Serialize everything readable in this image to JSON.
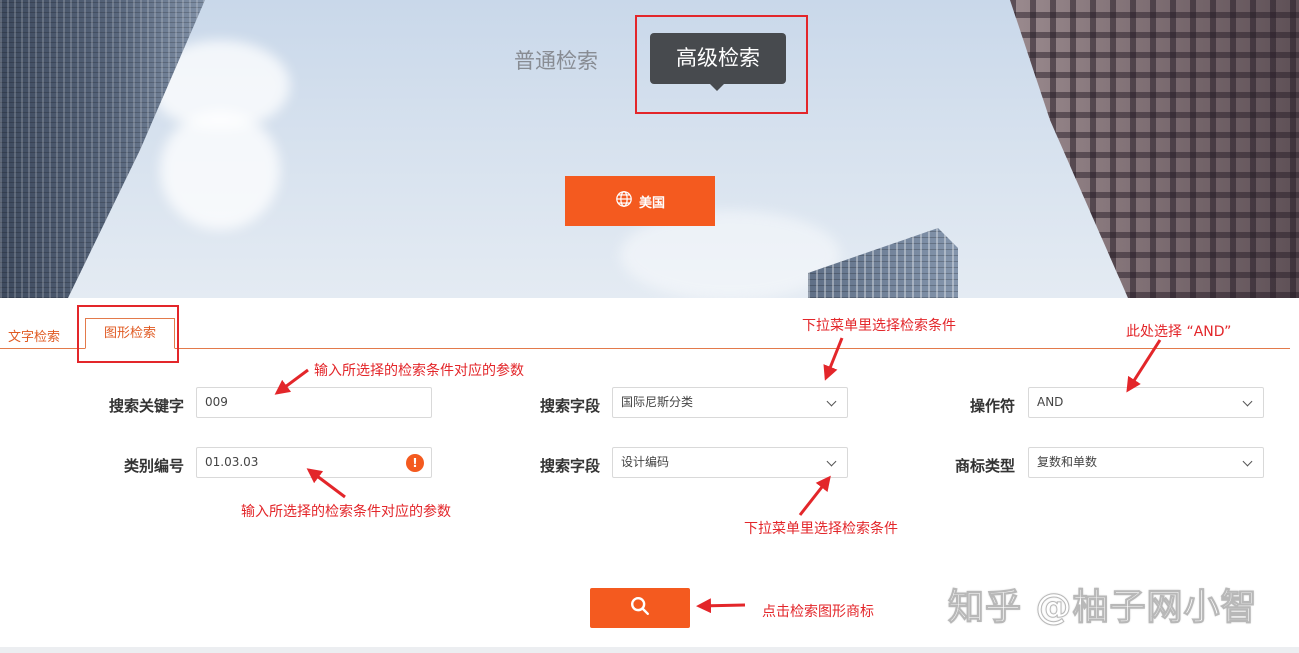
{
  "hero": {
    "mode_tabs": [
      {
        "label": "普通检索",
        "active": false
      },
      {
        "label": "高级检索",
        "active": true
      }
    ],
    "country_button": {
      "icon": "globe-icon",
      "label": "美国"
    }
  },
  "tabs": [
    {
      "label": "文字检索",
      "active": false
    },
    {
      "label": "图形检索",
      "active": true
    }
  ],
  "form": {
    "row1": {
      "keyword_label": "搜索关键字",
      "keyword_value": "009",
      "field_label": "搜索字段",
      "field_value": "国际尼斯分类",
      "operator_label": "操作符",
      "operator_value": "AND"
    },
    "row2": {
      "category_label": "类别编号",
      "category_value": "01.03.03",
      "field_label": "搜索字段",
      "field_value": "设计编码",
      "type_label": "商标类型",
      "type_value": "复数和单数"
    },
    "search_button_icon": "search-icon"
  },
  "annotations": {
    "dropdown_top": "下拉菜单里选择检索条件",
    "operator_hint": "此处选择 “AND”",
    "keyword_hint": "输入所选择的检索条件对应的参数",
    "category_hint": "输入所选择的检索条件对应的参数",
    "dropdown_bottom": "下拉菜单里选择检索条件",
    "search_hint": "点击检索图形商标"
  },
  "watermark": "知乎 @柚子网小智",
  "colors": {
    "accent": "#f45a1f",
    "annotation_red": "#e3262a",
    "dark_tab": "#474a4e"
  }
}
